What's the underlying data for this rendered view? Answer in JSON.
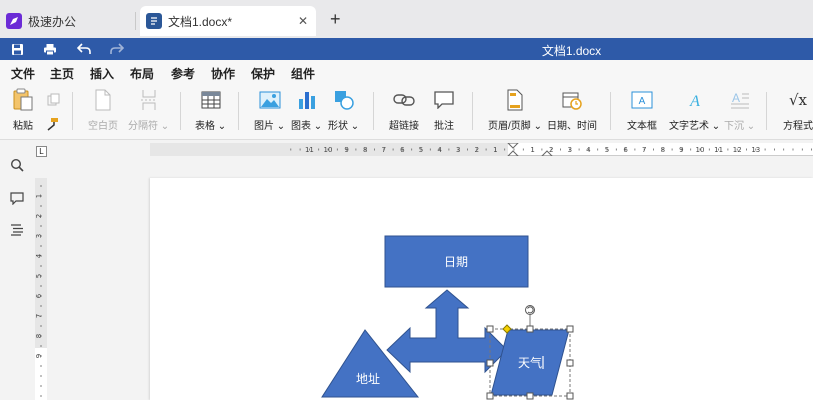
{
  "tabs": {
    "app_label": "极速办公",
    "doc_label": "文档1.docx*",
    "close_glyph": "✕",
    "new_tab_glyph": "+"
  },
  "title_bar": {
    "doc_title": "文档1.docx"
  },
  "menu": {
    "items": [
      "文件",
      "主页",
      "插入",
      "布局",
      "参考",
      "协作",
      "保护",
      "组件"
    ],
    "active": "插入"
  },
  "ribbon": {
    "paste": "粘贴",
    "blank_page": "空白页",
    "page_break": "分隔符",
    "table": "表格",
    "image": "图片",
    "chart": "图表",
    "shape": "形状",
    "hyperlink": "超链接",
    "comment": "批注",
    "header_footer": "页眉/页脚",
    "date_time": "日期、时间",
    "text_box": "文本框",
    "word_art": "文字艺术",
    "drop_cap": "下沉",
    "equation": "方程式",
    "dropdown_glyph": "⌄"
  },
  "ruler": {
    "corner_glyph": "L",
    "h_labels_left": [
      "11",
      "10",
      "9",
      "8",
      "7",
      "6",
      "5",
      "4",
      "3",
      "2",
      "1"
    ],
    "h_labels_right": [
      "1",
      "2",
      "3",
      "4",
      "5",
      "6",
      "7",
      "8",
      "9",
      "10",
      "11",
      "12",
      "13"
    ],
    "v_labels": [
      "1",
      "2",
      "3",
      "4",
      "5",
      "6",
      "7",
      "8",
      "9"
    ]
  },
  "shapes": {
    "date_label": "日期",
    "address_label": "地址",
    "weather_label": "天气"
  },
  "colors": {
    "accent": "#2e5aa8",
    "shape_fill": "#4472c4",
    "shape_stroke": "#2f528f"
  }
}
